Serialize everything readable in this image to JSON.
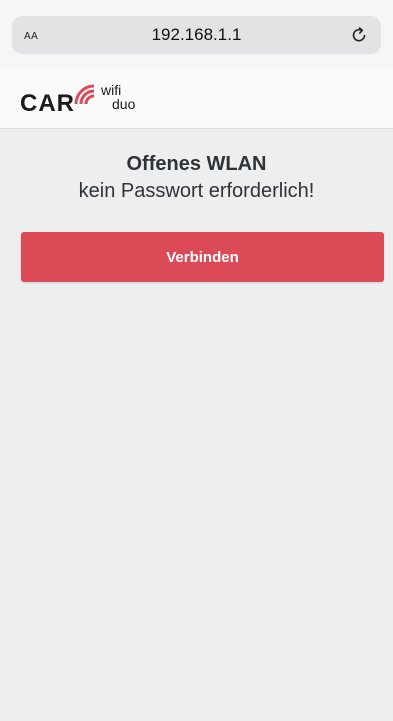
{
  "browser": {
    "text_size_label": "AA",
    "url": "192.168.1.1",
    "reload_icon": "reload-icon"
  },
  "header": {
    "logo": {
      "brand": "CAR",
      "wifi": "wifi",
      "duo": "duo",
      "signal_icon": "wifi-signal-icon"
    }
  },
  "main": {
    "title": "Offenes WLAN",
    "subtitle": "kein Passwort erforderlich!",
    "connect_label": "Verbinden"
  },
  "colors": {
    "accent": "#dc4a58",
    "background": "#eceef0",
    "text": "#2e3338"
  }
}
